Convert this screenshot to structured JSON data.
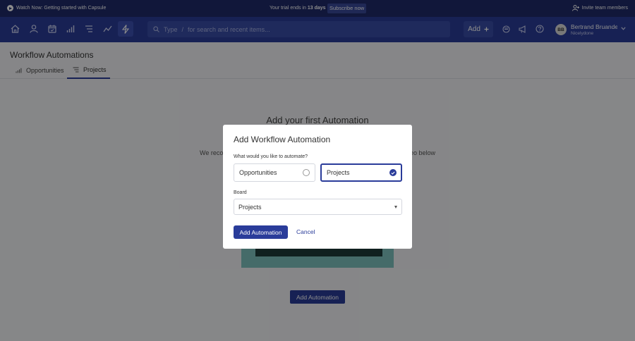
{
  "promo": {
    "watch_label": "Watch Now: Getting started with Capsule",
    "trial_prefix": "Your trial ends in",
    "trial_days": "13 days",
    "subscribe_label": "Subscribe now",
    "invite_label": "Invite team members"
  },
  "nav": {
    "search_type": "Type",
    "search_slash": "/",
    "search_placeholder": "for search and recent items...",
    "add_label": "Add",
    "user_initials": "BB",
    "user_name": "Bertrand Bruandet",
    "user_org": "Nicelydone"
  },
  "page": {
    "title": "Workflow Automations",
    "tabs": [
      {
        "label": "Opportunities"
      },
      {
        "label": "Projects"
      }
    ],
    "hero_title": "Add your first Automation",
    "hero_text_left": "We recom",
    "hero_text_right": "eo below",
    "bottom_button": "Add Automation"
  },
  "modal": {
    "title": "Add Workflow Automation",
    "question": "What would you like to automate?",
    "options": [
      {
        "label": "Opportunities",
        "selected": false
      },
      {
        "label": "Projects",
        "selected": true
      }
    ],
    "board_label": "Board",
    "board_value": "Projects",
    "add_button": "Add Automation",
    "cancel_button": "Cancel"
  },
  "colors": {
    "nav_bg": "#2a3c9a",
    "promo_bg": "#1f2a6b",
    "accent": "#2a3c9a"
  }
}
